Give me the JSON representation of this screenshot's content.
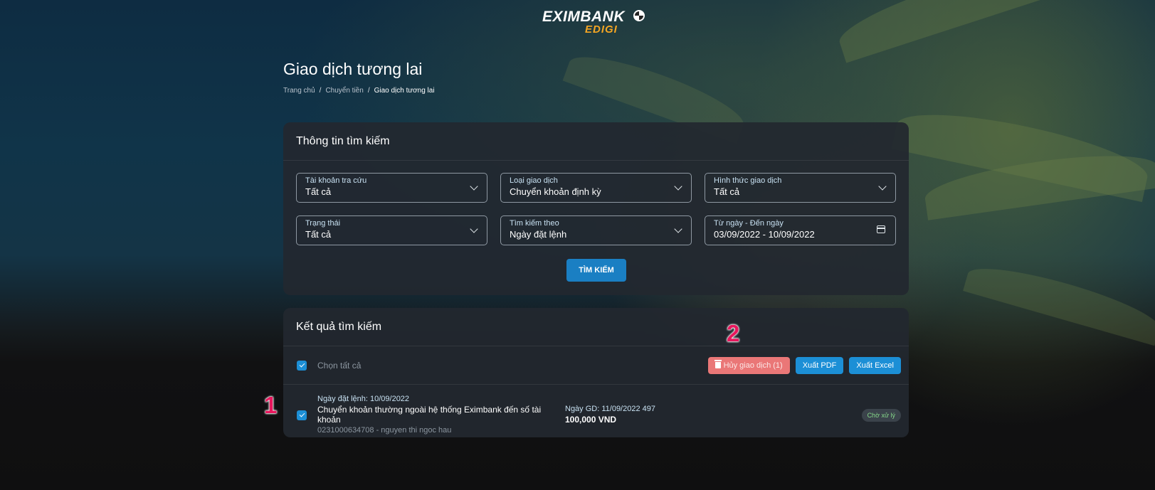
{
  "brand": {
    "name": "EXIMBANK",
    "sub": "EDIGI"
  },
  "page": {
    "title": "Giao dịch tương lai"
  },
  "breadcrumb": {
    "items": [
      "Trang chủ",
      "Chuyển tiền",
      "Giao dịch tương lai"
    ],
    "separator": "/"
  },
  "search": {
    "title": "Thông tin tìm kiếm",
    "fields": [
      {
        "label": "Tài khoản tra cứu",
        "value": "Tất cả",
        "icon": "chevron-down-icon"
      },
      {
        "label": "Loại giao dịch",
        "value": "Chuyển khoản định kỳ",
        "icon": "chevron-down-icon"
      },
      {
        "label": "Hình thức giao dịch",
        "value": "Tất cả",
        "icon": "chevron-down-icon"
      },
      {
        "label": "Trạng thái",
        "value": "Tất cả",
        "icon": "chevron-down-icon"
      },
      {
        "label": "Tìm kiếm theo",
        "value": "Ngày đặt lệnh",
        "icon": "chevron-down-icon"
      },
      {
        "label": "Từ ngày - Đến ngày",
        "value": "03/09/2022 - 10/09/2022",
        "icon": "calendar-icon"
      }
    ],
    "button_label": "TÌM KIẾM"
  },
  "results": {
    "title": "Kết quả tìm kiếm",
    "select_all_label": "Chọn tất cả",
    "select_all_checked": true,
    "buttons": {
      "cancel": "Hủy giao dịch (1)",
      "pdf": "Xuất PDF",
      "excel": "Xuất Excel"
    },
    "rows": [
      {
        "checked": true,
        "order_date": "Ngày đặt lệnh: 10/09/2022",
        "description": "Chuyển khoản thường ngoài hệ thống Eximbank đến số tài khoản",
        "account": "0231000634708 - nguyen thi ngoc hau",
        "txn_date": "Ngày GD: 11/09/2022 497",
        "amount": "100,000 VND",
        "status": "Chờ xử lý"
      }
    ]
  },
  "markers": [
    "1",
    "2"
  ],
  "colors": {
    "primary": "#1c8fd6",
    "danger": "#ea7777",
    "status_pending": "#86d98a",
    "marker": "#e8175d",
    "logo_accent": "#f5a623"
  }
}
